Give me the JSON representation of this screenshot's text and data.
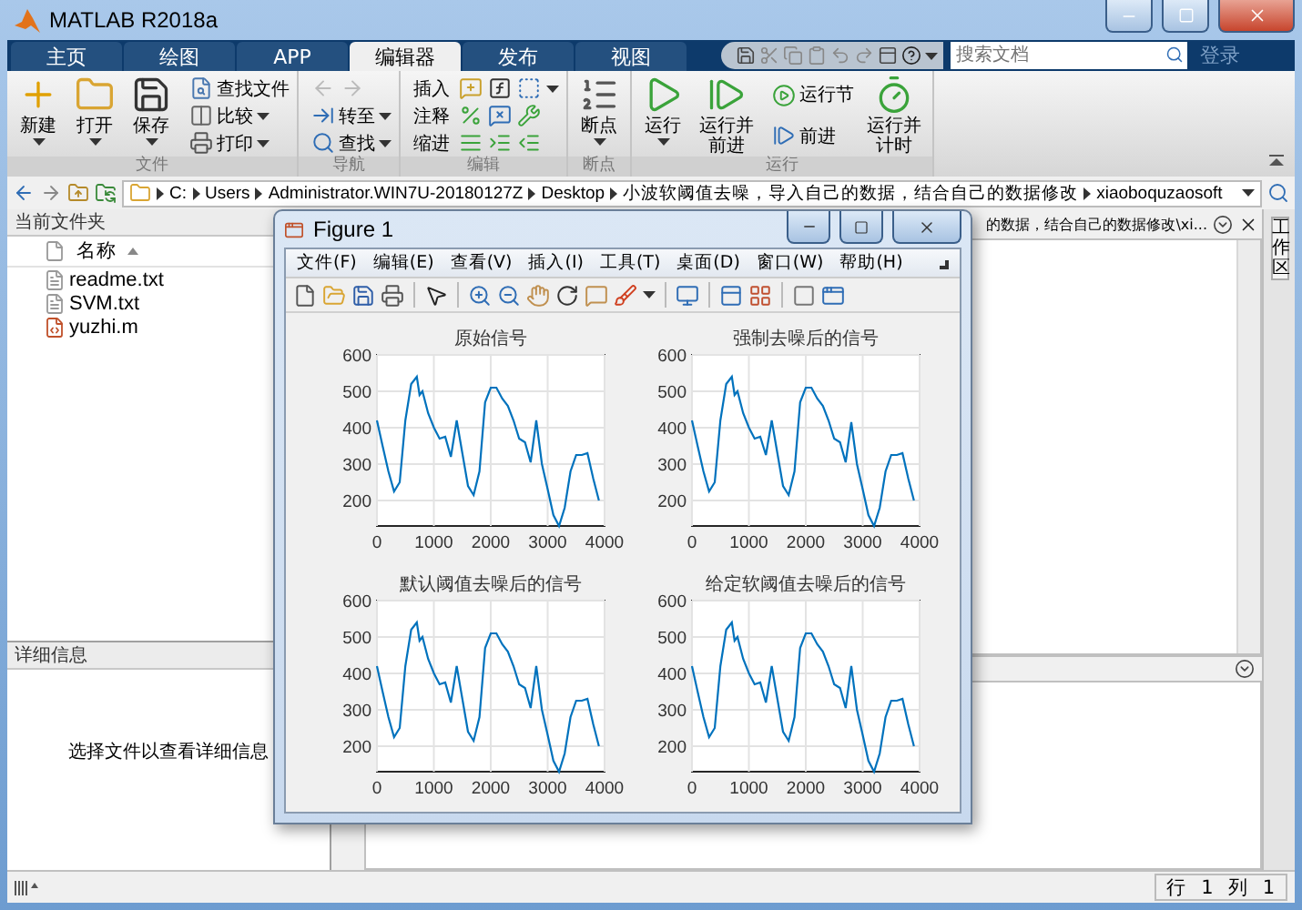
{
  "window": {
    "title": "MATLAB R2018a"
  },
  "tabs": [
    {
      "label": "主页",
      "selected": false
    },
    {
      "label": "绘图",
      "selected": false
    },
    {
      "label": "APP",
      "selected": false
    },
    {
      "label": "编辑器",
      "selected": true
    },
    {
      "label": "发布",
      "selected": false
    },
    {
      "label": "视图",
      "selected": false
    }
  ],
  "search": {
    "placeholder": "搜索文档"
  },
  "login": "登录",
  "ribbon": {
    "groups": [
      {
        "name": "文件",
        "items": [
          {
            "kind": "large",
            "label": "新建",
            "menu": true
          },
          {
            "kind": "large",
            "label": "打开",
            "menu": true
          },
          {
            "kind": "large",
            "label": "保存",
            "menu": true
          },
          {
            "kind": "stack",
            "rows": [
              {
                "kind": "button",
                "label": "查找文件",
                "menu": false
              },
              {
                "kind": "button",
                "label": "比较",
                "menu": true
              },
              {
                "kind": "button",
                "label": "打印",
                "menu": true
              }
            ]
          }
        ]
      },
      {
        "name": "导航",
        "items": [
          {
            "kind": "stack",
            "rows": [
              {
                "kind": "arrows",
                "disabled": true
              },
              {
                "kind": "button",
                "label": "转至",
                "menu": true
              },
              {
                "kind": "button",
                "label": "查找",
                "menu": true
              }
            ]
          }
        ]
      },
      {
        "name": "编辑",
        "items": [
          {
            "kind": "stack",
            "rows": [
              {
                "kind": "tools",
                "label": "插入",
                "menu": true
              },
              {
                "kind": "tools",
                "label": "注释",
                "menu": false
              },
              {
                "kind": "tools",
                "label": "缩进",
                "menu": false
              }
            ]
          }
        ]
      },
      {
        "name": "断点",
        "items": [
          {
            "kind": "large",
            "label": "断点",
            "menu": true
          }
        ]
      },
      {
        "name": "运行",
        "items": [
          {
            "kind": "large",
            "label": "运行",
            "menu": true
          },
          {
            "kind": "large",
            "label": "运行并前进",
            "menu": false
          },
          {
            "kind": "stack",
            "rows": [
              {
                "kind": "button",
                "label": "运行节",
                "menu": false
              },
              {
                "kind": "button",
                "label": "前进",
                "menu": false
              }
            ]
          },
          {
            "kind": "large",
            "label": "运行并计时",
            "menu": false
          }
        ]
      }
    ]
  },
  "address": {
    "segments": [
      "C:",
      "Users",
      "Administrator.WIN7U-20180127Z",
      "Desktop",
      "小波软阈值去噪，导入自己的数据，结合自己的数据修改",
      "xiaoboquzaosoft"
    ]
  },
  "current_folder": {
    "title": "当前文件夹",
    "column": "名称",
    "files": [
      {
        "name": "readme.txt",
        "kind": "text"
      },
      {
        "name": "SVM.txt",
        "kind": "text"
      },
      {
        "name": "yuzhi.m",
        "kind": "script"
      }
    ]
  },
  "details": {
    "title": "详细信息",
    "message": "选择文件以查看详细信息"
  },
  "editor": {
    "path": "的数据，结合自己的数据修改\\xi..."
  },
  "side_tab": "工作区",
  "figure": {
    "title": "Figure 1",
    "menus": [
      "文件(F)",
      "编辑(E)",
      "查看(V)",
      "插入(I)",
      "工具(T)",
      "桌面(D)",
      "窗口(W)",
      "帮助(H)"
    ],
    "charts": [
      {
        "chart_data": {
          "type": "line",
          "title": "原始信号",
          "x": [
            0,
            100,
            200,
            300,
            400,
            500,
            600,
            700,
            750,
            800,
            900,
            1000,
            1100,
            1200,
            1300,
            1400,
            1500,
            1600,
            1700,
            1800,
            1900,
            2000,
            2100,
            2200,
            2300,
            2400,
            2500,
            2600,
            2700,
            2800,
            2900,
            3000,
            3100,
            3200,
            3300,
            3400,
            3500,
            3600,
            3700,
            3800,
            3900
          ],
          "series": [
            {
              "color": "#0072bd",
              "values": [
                420,
                350,
                280,
                225,
                250,
                420,
                520,
                540,
                490,
                500,
                440,
                400,
                370,
                375,
                320,
                420,
                330,
                240,
                215,
                280,
                470,
                510,
                510,
                480,
                460,
                420,
                370,
                360,
                305,
                420,
                300,
                230,
                160,
                130,
                180,
                280,
                325,
                325,
                330,
                260,
                200
              ]
            }
          ],
          "xlim": [
            0,
            4000
          ],
          "ylim": [
            130,
            600
          ],
          "xticks": [
            0,
            1000,
            2000,
            3000,
            4000
          ],
          "yticks": [
            200,
            300,
            400,
            500,
            600
          ],
          "grid": true
        }
      },
      {
        "chart_data": {
          "type": "line",
          "title": "强制去噪后的信号",
          "x": [
            0,
            100,
            200,
            300,
            400,
            500,
            600,
            700,
            750,
            800,
            900,
            1000,
            1100,
            1200,
            1300,
            1400,
            1500,
            1600,
            1700,
            1800,
            1900,
            2000,
            2100,
            2200,
            2300,
            2400,
            2500,
            2600,
            2700,
            2800,
            2900,
            3000,
            3100,
            3200,
            3300,
            3400,
            3500,
            3600,
            3700,
            3800,
            3900
          ],
          "series": [
            {
              "color": "#0072bd",
              "values": [
                420,
                350,
                280,
                225,
                250,
                420,
                520,
                540,
                490,
                500,
                440,
                400,
                370,
                375,
                325,
                420,
                330,
                240,
                215,
                280,
                470,
                510,
                510,
                480,
                460,
                420,
                370,
                360,
                305,
                415,
                300,
                230,
                160,
                130,
                180,
                280,
                325,
                325,
                330,
                260,
                200
              ]
            }
          ],
          "xlim": [
            0,
            4000
          ],
          "ylim": [
            130,
            600
          ],
          "xticks": [
            0,
            1000,
            2000,
            3000,
            4000
          ],
          "yticks": [
            200,
            300,
            400,
            500,
            600
          ],
          "grid": true
        }
      },
      {
        "chart_data": {
          "type": "line",
          "title": "默认阈值去噪后的信号",
          "x": [
            0,
            100,
            200,
            300,
            400,
            500,
            600,
            700,
            750,
            800,
            900,
            1000,
            1100,
            1200,
            1300,
            1400,
            1500,
            1600,
            1700,
            1800,
            1900,
            2000,
            2100,
            2200,
            2300,
            2400,
            2500,
            2600,
            2700,
            2800,
            2900,
            3000,
            3100,
            3200,
            3300,
            3400,
            3500,
            3600,
            3700,
            3800,
            3900
          ],
          "series": [
            {
              "color": "#0072bd",
              "values": [
                420,
                350,
                280,
                225,
                250,
                420,
                520,
                540,
                490,
                500,
                440,
                400,
                370,
                375,
                320,
                420,
                330,
                240,
                215,
                280,
                470,
                510,
                510,
                480,
                460,
                420,
                370,
                360,
                305,
                420,
                300,
                230,
                160,
                130,
                180,
                280,
                325,
                325,
                330,
                260,
                200
              ]
            }
          ],
          "xlim": [
            0,
            4000
          ],
          "ylim": [
            130,
            600
          ],
          "xticks": [
            0,
            1000,
            2000,
            3000,
            4000
          ],
          "yticks": [
            200,
            300,
            400,
            500,
            600
          ],
          "grid": true
        }
      },
      {
        "chart_data": {
          "type": "line",
          "title": "给定软阈值去噪后的信号",
          "x": [
            0,
            100,
            200,
            300,
            400,
            500,
            600,
            700,
            750,
            800,
            900,
            1000,
            1100,
            1200,
            1300,
            1400,
            1500,
            1600,
            1700,
            1800,
            1900,
            2000,
            2100,
            2200,
            2300,
            2400,
            2500,
            2600,
            2700,
            2800,
            2900,
            3000,
            3100,
            3200,
            3300,
            3400,
            3500,
            3600,
            3700,
            3800,
            3900
          ],
          "series": [
            {
              "color": "#0072bd",
              "values": [
                420,
                350,
                280,
                225,
                250,
                420,
                520,
                540,
                490,
                500,
                440,
                400,
                370,
                375,
                320,
                420,
                330,
                240,
                215,
                280,
                470,
                510,
                510,
                480,
                460,
                420,
                370,
                360,
                305,
                420,
                300,
                230,
                160,
                130,
                180,
                280,
                325,
                325,
                330,
                260,
                200
              ]
            }
          ],
          "xlim": [
            0,
            4000
          ],
          "ylim": [
            130,
            600
          ],
          "xticks": [
            0,
            1000,
            2000,
            3000,
            4000
          ],
          "yticks": [
            200,
            300,
            400,
            500,
            600
          ],
          "grid": true
        }
      }
    ]
  },
  "status_bar": {
    "row_label": "行",
    "row": "1",
    "col_label": "列",
    "col": "1"
  }
}
